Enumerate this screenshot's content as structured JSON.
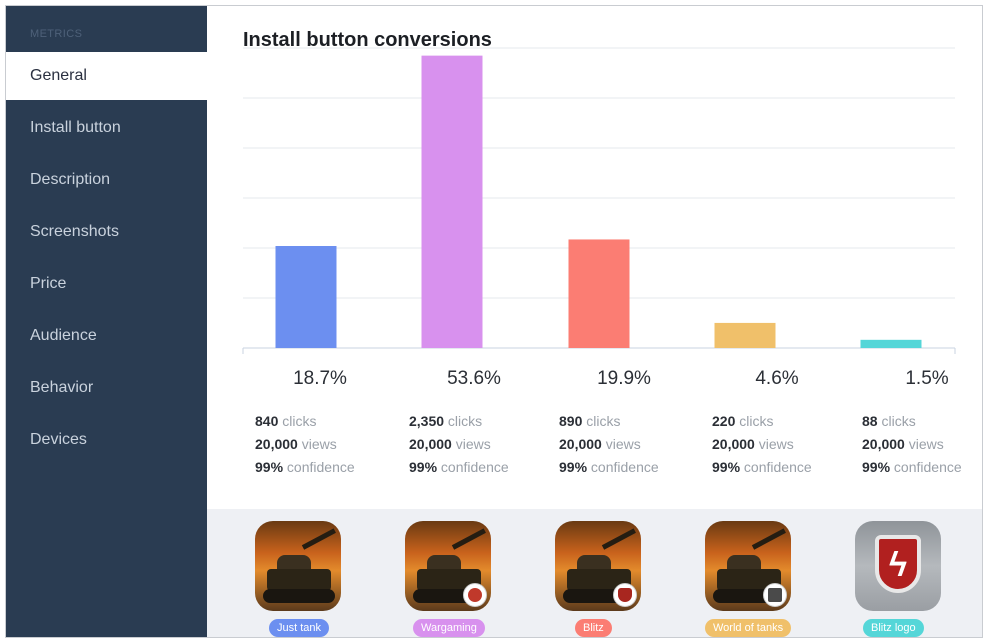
{
  "sidebar": {
    "header": "METRICS",
    "items": [
      {
        "label": "General",
        "active": true
      },
      {
        "label": "Install button",
        "active": false
      },
      {
        "label": "Description",
        "active": false
      },
      {
        "label": "Screenshots",
        "active": false
      },
      {
        "label": "Price",
        "active": false
      },
      {
        "label": "Audience",
        "active": false
      },
      {
        "label": "Behavior",
        "active": false
      },
      {
        "label": "Devices",
        "active": false
      }
    ]
  },
  "main": {
    "title": "Install button conversions"
  },
  "chart_data": {
    "type": "bar",
    "title": "Install button conversions",
    "categories": [
      "Just tank",
      "Wargaming",
      "Blitz",
      "World of tanks",
      "Blitz logo"
    ],
    "values": [
      18.7,
      53.6,
      19.9,
      4.6,
      1.5
    ],
    "colors": [
      "#6c8ff0",
      "#d891ee",
      "#fb7d73",
      "#f0c06a",
      "#55d6d8"
    ],
    "ylim": [
      0,
      55
    ],
    "grid": true,
    "gridlines": 6,
    "xlabel": "",
    "ylabel": ""
  },
  "stats": [
    {
      "pct": "18.7%",
      "clicks": "840",
      "clicks_label": " clicks",
      "views": "20,000",
      "views_label": " views",
      "confidence": "99%",
      "confidence_label": " confidence"
    },
    {
      "pct": "53.6%",
      "clicks": "2,350",
      "clicks_label": " clicks",
      "views": "20,000",
      "views_label": " views",
      "confidence": "99%",
      "confidence_label": " confidence"
    },
    {
      "pct": "19.9%",
      "clicks": "890",
      "clicks_label": " clicks",
      "views": "20,000",
      "views_label": " views",
      "confidence": "99%",
      "confidence_label": " confidence"
    },
    {
      "pct": "4.6%",
      "clicks": "220",
      "clicks_label": " clicks",
      "views": "20,000",
      "views_label": " views",
      "confidence": "99%",
      "confidence_label": " confidence"
    },
    {
      "pct": "1.5%",
      "clicks": "88",
      "clicks_label": " clicks",
      "views": "20,000",
      "views_label": " views",
      "confidence": "99%",
      "confidence_label": " confidence"
    }
  ],
  "variants": [
    {
      "label": "Just tank",
      "icon": "tank-icon",
      "badge": null,
      "color": "#6c8ff0"
    },
    {
      "label": "Wargaming",
      "icon": "tank-icon",
      "badge": "wargaming-badge-icon",
      "color": "#d891ee"
    },
    {
      "label": "Blitz",
      "icon": "tank-icon",
      "badge": "blitz-badge-icon",
      "color": "#fb7d73"
    },
    {
      "label": "World of tanks",
      "icon": "tank-icon",
      "badge": "world-of-tanks-badge-icon",
      "color": "#f0c06a"
    },
    {
      "label": "Blitz logo",
      "icon": "blitz-logo-icon",
      "badge": null,
      "color": "#55d6d8"
    }
  ]
}
